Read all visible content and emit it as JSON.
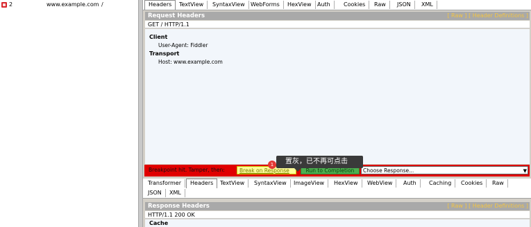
{
  "session": {
    "number": "2",
    "host": "www.example.com",
    "url": "/"
  },
  "request": {
    "tabs": [
      "Headers",
      "TextView",
      "SyntaxView",
      "WebForms",
      "HexView",
      "Auth",
      "Cookies",
      "Raw",
      "JSON",
      "XML"
    ],
    "active_tab": "Headers",
    "header_title": "Request Headers",
    "header_links": "[ Raw ]   [ Header Definitions ]",
    "request_line": "GET / HTTP/1.1",
    "groups": [
      {
        "name": "Client",
        "items": [
          "User-Agent: Fiddler"
        ]
      },
      {
        "name": "Transport",
        "items": [
          "Host: www.example.com"
        ]
      }
    ]
  },
  "breakpoint": {
    "message": "Breakpoint hit. Tamper, then:",
    "break_label": "Break on Response",
    "run_label": "Run to Completion",
    "choose_response": "Choose Response..."
  },
  "tooltip": {
    "badge": "1",
    "text": "置灰，已不再可点击"
  },
  "response": {
    "tabs_row1": [
      "Transformer",
      "Headers",
      "TextView",
      "SyntaxView",
      "ImageView",
      "HexView",
      "WebView",
      "Auth",
      "Caching",
      "Cookies",
      "Raw"
    ],
    "tabs_row2": [
      "JSON",
      "XML"
    ],
    "active_tab": "Headers",
    "header_title": "Response Headers",
    "header_links": "[ Raw ]   [ Header Definitions ]",
    "status_line": "HTTP/1.1 200 OK",
    "first_group": "Cache"
  },
  "colors": {
    "breakpoint_red": "#e00000",
    "run_green": "#4caf50",
    "header_gray": "#a9a9a9",
    "link_yellow": "#f4c542"
  }
}
